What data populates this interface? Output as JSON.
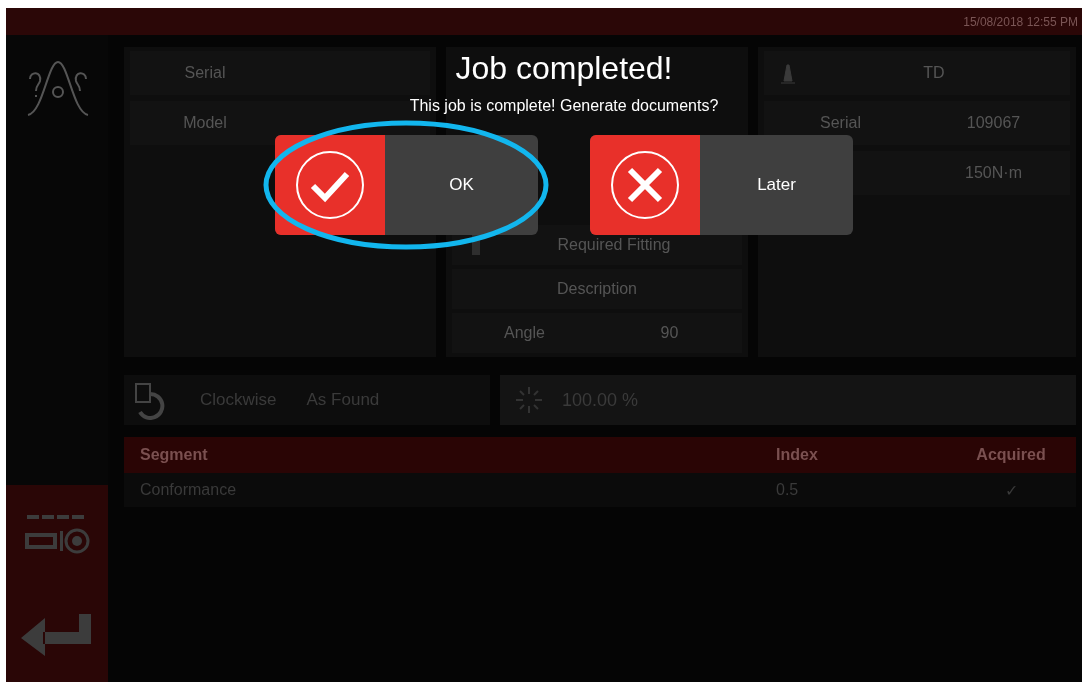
{
  "status_bar": {
    "timestamp": "15/08/2018 12:55 PM"
  },
  "instrument_card": {
    "rows": [
      {
        "label": "Serial"
      },
      {
        "label": "Model"
      }
    ]
  },
  "fitting_card": {
    "rows": [
      {
        "label": "Required Fitting",
        "value": ""
      },
      {
        "label": "Description",
        "value": ""
      },
      {
        "label": "Angle",
        "value": "90"
      }
    ]
  },
  "tool_card": {
    "title": "TD",
    "rows": [
      {
        "label": "Serial",
        "value": "109067"
      },
      {
        "label": "",
        "value": "150N·m"
      }
    ]
  },
  "mode_bar": {
    "direction": "Clockwise",
    "stage": "As Found",
    "progress": "100.00 %"
  },
  "table": {
    "columns": [
      "Segment",
      "Index",
      "Acquired"
    ],
    "rows": [
      [
        "Conformance",
        "0.5",
        "✓"
      ]
    ]
  },
  "dialog": {
    "title": "Job completed!",
    "message": "This job is complete! Generate documents?",
    "buttons": [
      {
        "kind": "confirm",
        "label": "OK",
        "highlighted": true
      },
      {
        "kind": "cancel",
        "label": "Later",
        "highlighted": false
      }
    ]
  }
}
